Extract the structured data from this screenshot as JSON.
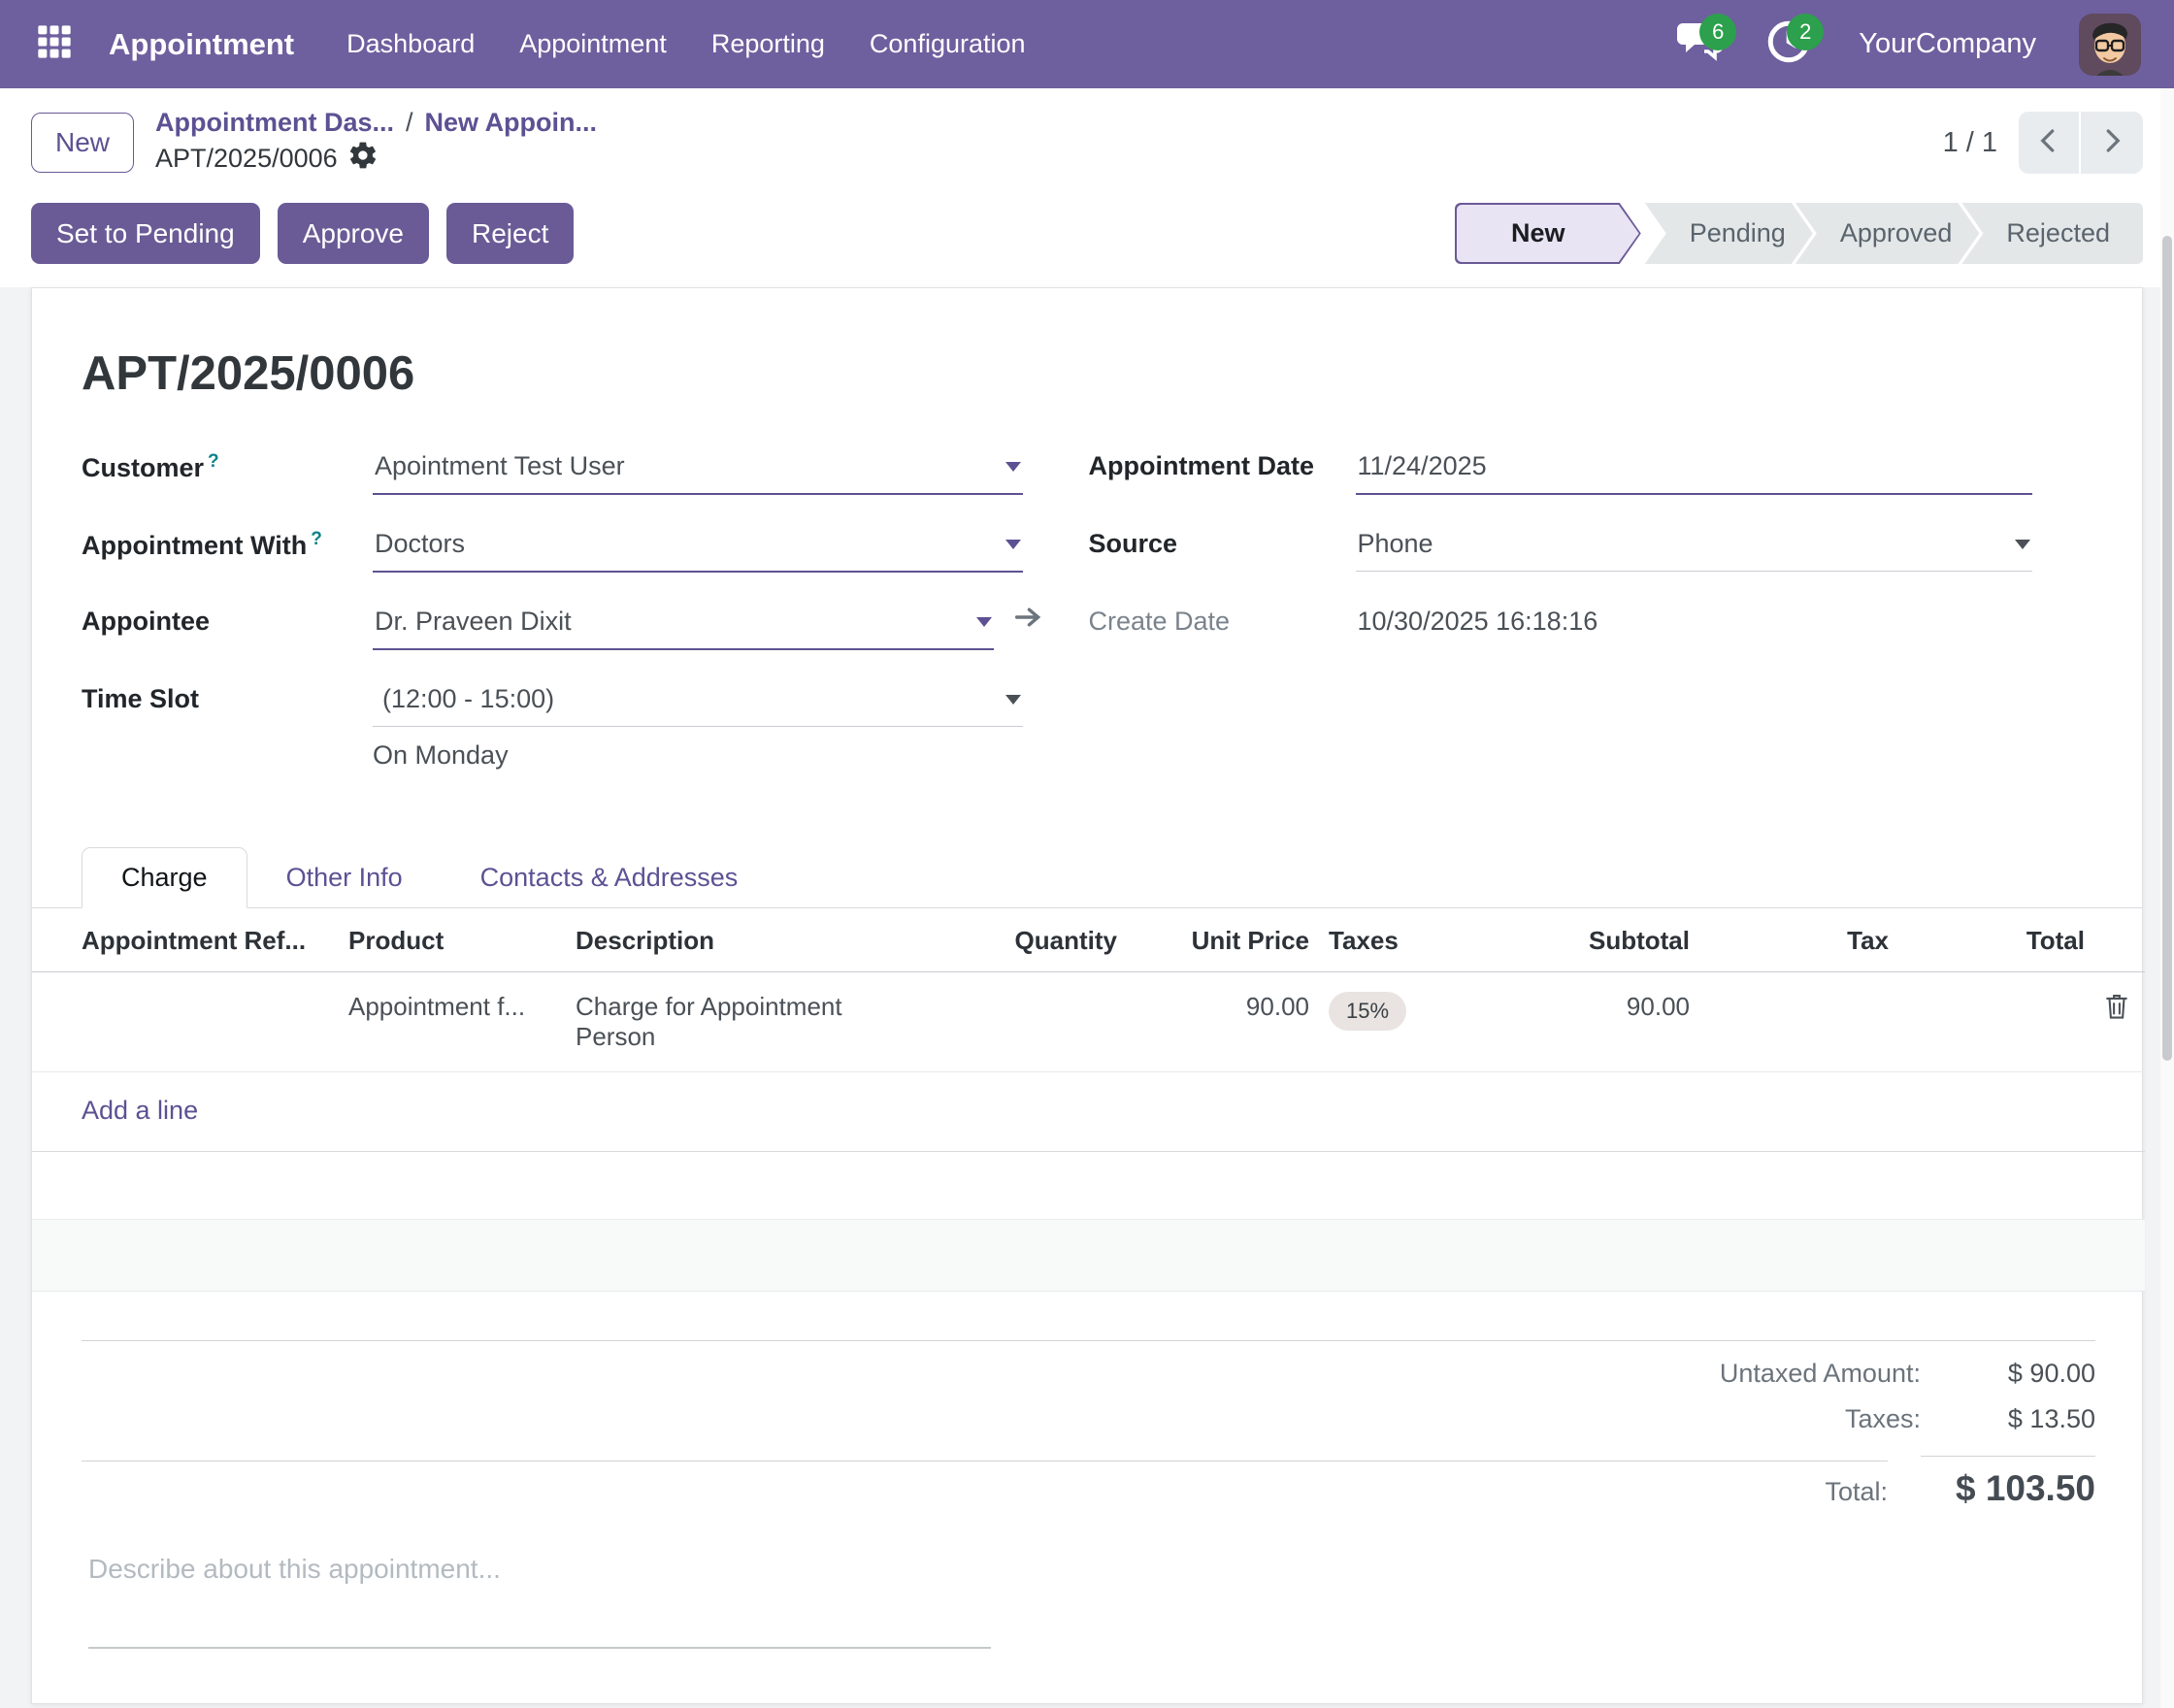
{
  "nav": {
    "app_name": "Appointment",
    "items": [
      "Dashboard",
      "Appointment",
      "Reporting",
      "Configuration"
    ],
    "messages_badge": "6",
    "activities_badge": "2",
    "company": "YourCompany"
  },
  "control": {
    "new_button": "New",
    "breadcrumb_parent": "Appointment Das...",
    "breadcrumb_sep": "/",
    "breadcrumb_prev": "New Appoin...",
    "breadcrumb_active": "APT/2025/0006",
    "pager": "1 / 1"
  },
  "actions": {
    "set_pending": "Set to Pending",
    "approve": "Approve",
    "reject": "Reject"
  },
  "statusbar": {
    "steps": [
      {
        "label": "New",
        "active": true
      },
      {
        "label": "Pending",
        "active": false
      },
      {
        "label": "Approved",
        "active": false
      },
      {
        "label": "Rejected",
        "active": false
      }
    ]
  },
  "form": {
    "title": "APT/2025/0006",
    "help_mark": "?",
    "customer": {
      "label": "Customer",
      "value": "Apointment Test User"
    },
    "appointment_with": {
      "label": "Appointment With",
      "value": "Doctors"
    },
    "appointee": {
      "label": "Appointee",
      "value": "Dr. Praveen Dixit"
    },
    "time_slot": {
      "label": "Time Slot",
      "value": "(12:00 - 15:00)",
      "note": "On Monday"
    },
    "appointment_date": {
      "label": "Appointment Date",
      "value": "11/24/2025"
    },
    "source": {
      "label": "Source",
      "value": "Phone"
    },
    "create_date": {
      "label": "Create Date",
      "value": "10/30/2025 16:18:16"
    }
  },
  "tabs": [
    {
      "label": "Charge",
      "active": true
    },
    {
      "label": "Other Info",
      "active": false
    },
    {
      "label": "Contacts & Addresses",
      "active": false
    }
  ],
  "table": {
    "headers": [
      "Appointment Ref...",
      "Product",
      "Description",
      "Quantity",
      "Unit Price",
      "Taxes",
      "Subtotal",
      "Tax",
      "Total"
    ],
    "rows": [
      {
        "appointment_ref": "",
        "product": "Appointment f...",
        "description": "Charge for Appointment Person",
        "quantity": "",
        "unit_price": "90.00",
        "taxes": "15%",
        "subtotal": "90.00",
        "tax": "",
        "total": ""
      }
    ],
    "add_line": "Add a line"
  },
  "totals": {
    "untaxed_label": "Untaxed Amount:",
    "untaxed_value": "$ 90.00",
    "taxes_label": "Taxes:",
    "taxes_value": "$ 13.50",
    "total_label": "Total:",
    "total_value": "$ 103.50"
  },
  "notes": {
    "placeholder": "Describe about this appointment..."
  },
  "icons": {
    "apps": "grid-icon",
    "messages": "chat-bubbles-icon",
    "activities": "clock-icon",
    "settings": "gear-icon",
    "dropdown": "caret-down-icon",
    "internal_link": "arrow-right-icon",
    "delete": "trash-icon",
    "pager_previous": "chevron-left-icon",
    "pager_next": "chevron-right-icon"
  },
  "colors": {
    "navbar": "#6e5f9e",
    "primary_button": "#6a5a96",
    "link": "#5d5193",
    "badge_green": "#2ca04c",
    "status_active_bg": "#e9e4f3",
    "status_inactive_bg": "#e4e7e7",
    "underline_purple": "#5e5191",
    "taxes_pill_bg": "#e9e4e1"
  }
}
